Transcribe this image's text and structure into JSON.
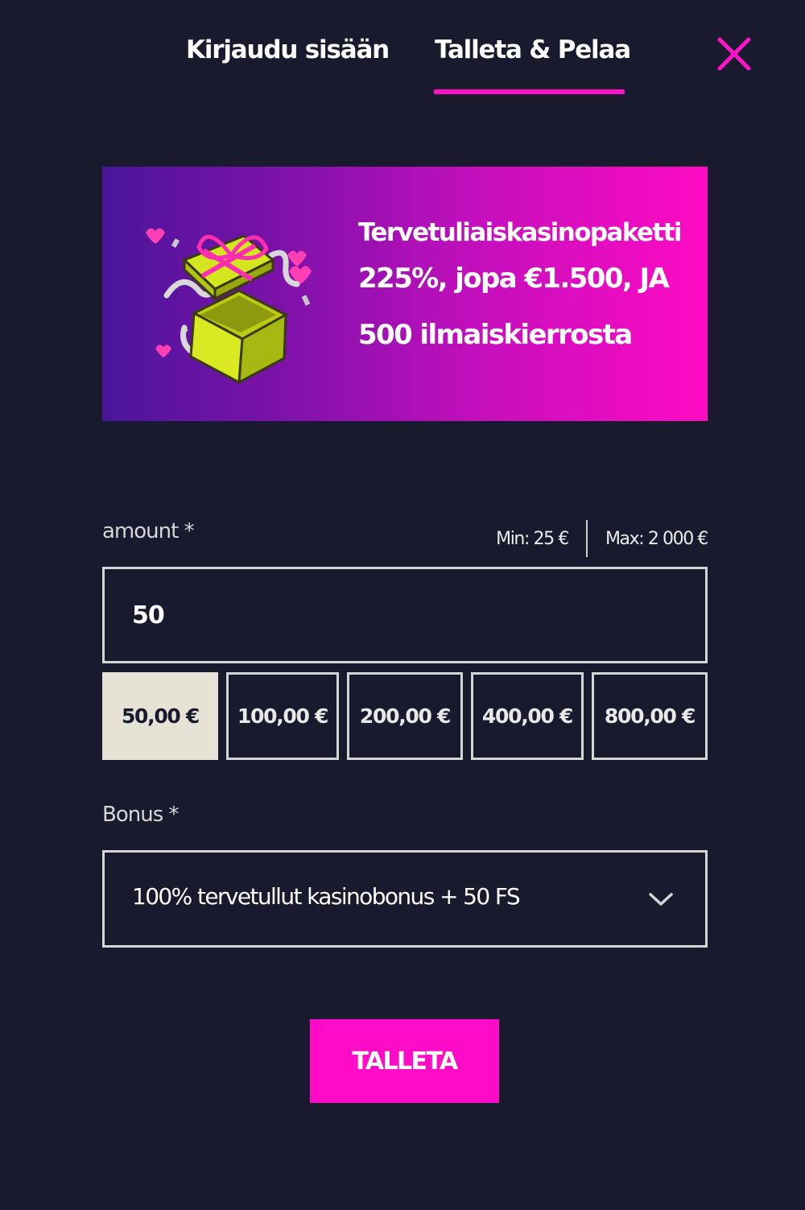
{
  "tabs": {
    "login_label": "Kirjaudu sisään",
    "deposit_label": "Talleta & Pelaa",
    "active": "deposit"
  },
  "banner": {
    "line1": "Tervetuliaiskasinopaketti",
    "line2": "225%, jopa €1.500, JA",
    "line3": "500 ilmaiskierrosta",
    "image_icon": "gift-box-icon"
  },
  "amount": {
    "label": "amount *",
    "min": "Min: 25 €",
    "max": "Max: 2 000 €",
    "value": "50",
    "quick_options": [
      "50,00 €",
      "100,00 €",
      "200,00 €",
      "400,00 €",
      "800,00 €"
    ],
    "selected_option": "50,00 €"
  },
  "bonus": {
    "label": "Bonus *",
    "selected": "100% tervetullut kasinobonus + 50 FS"
  },
  "submit_label": "TALLETA",
  "colors": {
    "background": "#1a1a2e",
    "accent": "#ff0bc8",
    "selected_chip": "#e6e3d6",
    "banner_start": "#4a169a",
    "banner_end": "#ff0bc3"
  }
}
